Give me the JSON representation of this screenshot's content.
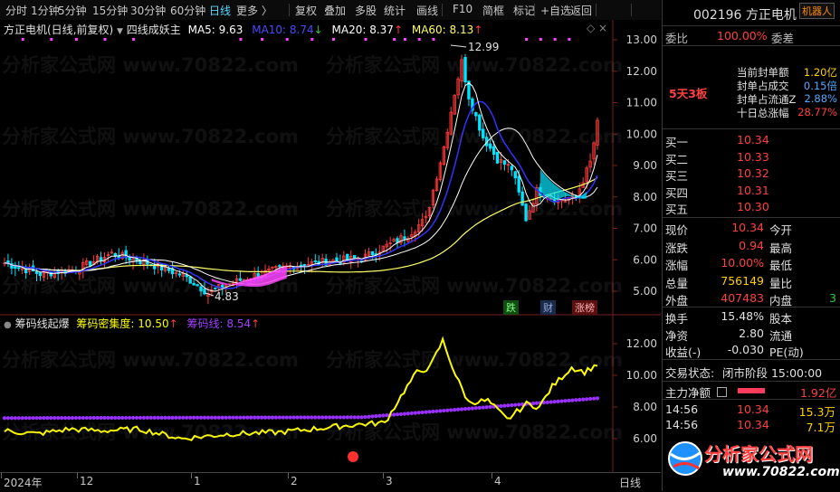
{
  "toolbar": {
    "items": [
      "分时",
      "1分钟",
      "5分钟",
      "15分钟",
      "30分钟",
      "60分钟",
      "日线",
      "更多 〉",
      "复权",
      "叠加",
      "多股",
      "统计",
      "画线",
      "F10",
      "简框",
      "标记",
      "+自选",
      "返回"
    ],
    "active_index": 6
  },
  "main_chart": {
    "title": "方正电机(日线,前复权)",
    "indicator_name": "四线成妖主",
    "ma5": "MA5: 9.63",
    "ma10": "MA10: 8.74",
    "ma20": "MA20: 8.37",
    "ma60": "MA60: 8.13",
    "high_label": "12.99",
    "low_label": "4.83",
    "y_ticks": [
      "13.00",
      "12.00",
      "11.00",
      "10.00",
      "9.00",
      "8.00",
      "7.00",
      "6.00",
      "5.00"
    ],
    "badges": [
      "跌",
      "财",
      "涨榜"
    ],
    "colors": {
      "up": "#ff3b3b",
      "down": "#00e5ff",
      "ma5": "#ffffff",
      "ma10": "#3232ff",
      "ma20": "#ffffff",
      "ma60": "#ffff66",
      "pink": "#ff44ff"
    }
  },
  "sub_chart": {
    "name": "筹码线起爆",
    "density_label": "筹码密集度: 10.50",
    "line_label": "筹码线: 8.54",
    "y_ticks": [
      "12.00",
      "10.00",
      "8.00",
      "6.00"
    ],
    "colors": {
      "density": "#ffff00",
      "line": "#9a30ff"
    }
  },
  "x_axis": {
    "labels": [
      "2024年",
      "12",
      "1",
      "2",
      "3",
      "4",
      "日线"
    ]
  },
  "panel": {
    "code": "002196",
    "name": "方正电机",
    "robot": "机器人",
    "weibi_label": "委比",
    "weibi_value": "100.00%",
    "weicha_label": "委差",
    "board_tag": "5天3板",
    "stats": [
      {
        "label": "当前封单额",
        "value": "1.20亿"
      },
      {
        "label": "封单占成交",
        "value": "0.15倍"
      },
      {
        "label": "封单占流通Z",
        "value": "2.88%"
      },
      {
        "label": "十日总涨幅",
        "value": "28.77%"
      }
    ],
    "bids": [
      {
        "label": "买一",
        "price": "10.34"
      },
      {
        "label": "买二",
        "price": "10.33"
      },
      {
        "label": "买三",
        "price": "10.32"
      },
      {
        "label": "买四",
        "price": "10.31"
      },
      {
        "label": "买五",
        "price": "10.30"
      }
    ],
    "quote": [
      {
        "l1": "现价",
        "v1": "10.34",
        "l2": "今开"
      },
      {
        "l1": "涨跌",
        "v1": "0.94",
        "l2": "最高"
      },
      {
        "l1": "涨幅",
        "v1": "10.00%",
        "l2": "最低"
      },
      {
        "l1": "总量",
        "v1": "756149",
        "l2": "量比"
      },
      {
        "l1": "外盘",
        "v1": "407483",
        "l2": "内盘"
      }
    ],
    "turnover": [
      {
        "l1": "换手",
        "v1": "15.48%",
        "l2": "股本"
      },
      {
        "l1": "净资",
        "v1": "2.80",
        "l2": "流通"
      },
      {
        "l1": "收益(-)",
        "v1": "-0.030",
        "l2": "PE(动)"
      }
    ],
    "trade_status_label": "交易状态:",
    "trade_status_value": "闭市阶段 15:00:00",
    "net_flow_label": "主力净额",
    "net_flow_value": "1.92亿",
    "ticks": [
      {
        "time": "14:56",
        "price": "10.34",
        "vol": "15.3万"
      },
      {
        "time": "14:56",
        "price": "10.34",
        "vol": "7.1万"
      },
      {
        "time": "14:56",
        "price": "10.34",
        "vol": "25.0万"
      }
    ],
    "logo_text": "分析家公式网",
    "logo_url": "www.70822.com"
  },
  "watermark": "分析家公式网 www.70822.com"
}
